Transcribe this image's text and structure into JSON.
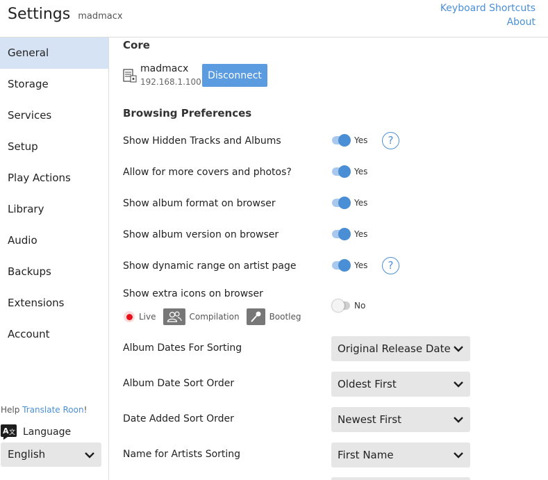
{
  "header": {
    "title": "Settings",
    "subtitle": "madmacx",
    "keyboard_shortcuts": "Keyboard Shortcuts",
    "about": "About"
  },
  "sidebar": {
    "items": [
      {
        "label": "General",
        "active": true
      },
      {
        "label": "Storage"
      },
      {
        "label": "Services"
      },
      {
        "label": "Setup"
      },
      {
        "label": "Play Actions"
      },
      {
        "label": "Library"
      },
      {
        "label": "Audio"
      },
      {
        "label": "Backups"
      },
      {
        "label": "Extensions"
      },
      {
        "label": "Account"
      }
    ],
    "help_prefix": "Help ",
    "help_link": "Translate Roon",
    "help_suffix": "!",
    "language_label": "Language",
    "language_value": "English"
  },
  "core": {
    "heading": "Core",
    "name": "madmacx",
    "ip": "192.168.1.100",
    "disconnect_label": "Disconnect"
  },
  "browsing": {
    "heading": "Browsing Preferences",
    "toggles": [
      {
        "label": "Show Hidden Tracks and Albums",
        "state": "Yes",
        "on": true,
        "help": true
      },
      {
        "label": "Allow for more covers and photos?",
        "state": "Yes",
        "on": true,
        "help": false
      },
      {
        "label": "Show album format on browser",
        "state": "Yes",
        "on": true,
        "help": false
      },
      {
        "label": "Show album version on browser",
        "state": "Yes",
        "on": true,
        "help": false
      },
      {
        "label": "Show dynamic range on artist page",
        "state": "Yes",
        "on": true,
        "help": true
      },
      {
        "label": "Show extra icons on browser",
        "state": "No",
        "on": false,
        "help": false
      }
    ],
    "help_glyph": "?",
    "extra_icons": {
      "live": "Live",
      "compilation": "Compilation",
      "bootleg": "Bootleg"
    },
    "selects": [
      {
        "label": "Album Dates For Sorting",
        "value": "Original Release Date"
      },
      {
        "label": "Album Date Sort Order",
        "value": "Oldest First"
      },
      {
        "label": "Date Added Sort Order",
        "value": "Newest First"
      },
      {
        "label": "Name for Artists Sorting",
        "value": "First Name"
      }
    ]
  },
  "colors": {
    "accent": "#4a8fd6",
    "button": "#5b9ce0",
    "active_nav": "#d5e3f4",
    "live_red": "#e8111a"
  }
}
